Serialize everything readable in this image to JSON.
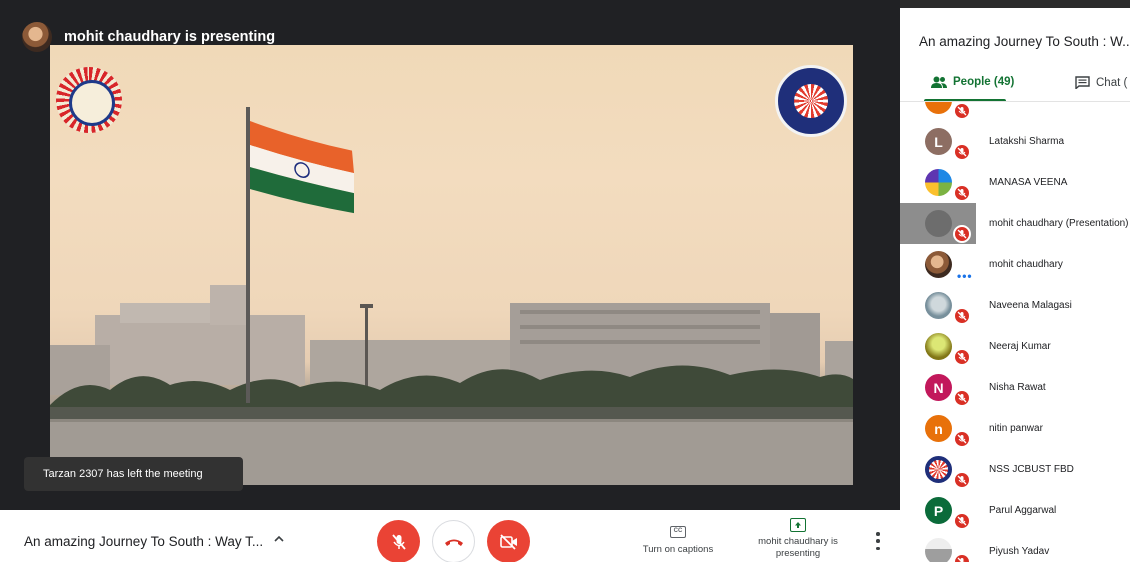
{
  "presenter": {
    "label": "mohit chaudhary is presenting"
  },
  "toast": {
    "text": "Tarzan 2307 has left the meeting"
  },
  "panel": {
    "title": "An amazing Journey To South : W...",
    "tabs": [
      {
        "label": "People (49)",
        "icon": "people-icon",
        "selected": true
      },
      {
        "label": "Chat (",
        "icon": "chat-icon",
        "selected": false
      }
    ]
  },
  "people": [
    {
      "name": "",
      "initial": "",
      "avatar_color": "#e8710a",
      "status": "muted"
    },
    {
      "name": "Latakshi Sharma",
      "initial": "L",
      "avatar_color": "#8d6e63",
      "status": "muted"
    },
    {
      "name": "MANASA VEENA",
      "initial": "",
      "avatar_color": "#7cb342",
      "status": "muted"
    },
    {
      "name": "mohit chaudhary (Presentation)",
      "initial": "",
      "avatar_color": "#6d6d6d",
      "status": "muted",
      "highlighted": true
    },
    {
      "name": "mohit chaudhary",
      "initial": "",
      "avatar_color": "#8d5a3a",
      "status": "speaking"
    },
    {
      "name": "Naveena Malagasi",
      "initial": "",
      "avatar_color": "#90a4ae",
      "status": "muted"
    },
    {
      "name": "Neeraj Kumar",
      "initial": "",
      "avatar_color": "#9e9d24",
      "status": "muted"
    },
    {
      "name": "Nisha Rawat",
      "initial": "N",
      "avatar_color": "#c2185b",
      "status": "muted"
    },
    {
      "name": "nitin panwar",
      "initial": "n",
      "avatar_color": "#e8710a",
      "status": "muted"
    },
    {
      "name": "NSS JCBUST FBD",
      "initial": "",
      "avatar_color": "#1f2f7a",
      "status": "muted"
    },
    {
      "name": "Parul Aggarwal",
      "initial": "P",
      "avatar_color": "#0b6b3a",
      "status": "muted"
    },
    {
      "name": "Piyush Yadav",
      "initial": "",
      "avatar_color": "#bdbdbd",
      "status": "muted"
    }
  ],
  "bottom": {
    "meeting_title": "An amazing Journey To South : Way T...",
    "captions_label": "Turn on captions",
    "captions_icon_text": "CC",
    "presenting_label": "mohit chaudhary is presenting"
  },
  "colors": {
    "accent_green": "#137333",
    "red": "#ea4335",
    "dark_stage": "#202124"
  }
}
